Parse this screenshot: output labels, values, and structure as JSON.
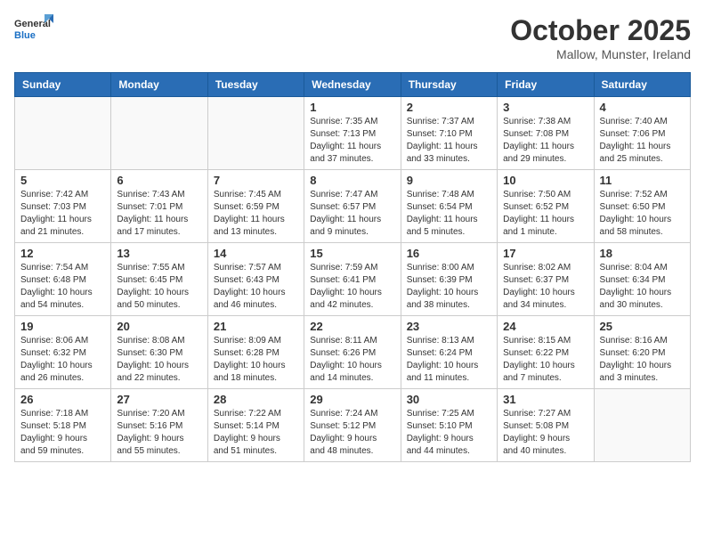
{
  "logo": {
    "text_general": "General",
    "text_blue": "Blue"
  },
  "header": {
    "month": "October 2025",
    "location": "Mallow, Munster, Ireland"
  },
  "weekdays": [
    "Sunday",
    "Monday",
    "Tuesday",
    "Wednesday",
    "Thursday",
    "Friday",
    "Saturday"
  ],
  "weeks": [
    [
      {
        "day": "",
        "info": ""
      },
      {
        "day": "",
        "info": ""
      },
      {
        "day": "",
        "info": ""
      },
      {
        "day": "1",
        "info": "Sunrise: 7:35 AM\nSunset: 7:13 PM\nDaylight: 11 hours\nand 37 minutes."
      },
      {
        "day": "2",
        "info": "Sunrise: 7:37 AM\nSunset: 7:10 PM\nDaylight: 11 hours\nand 33 minutes."
      },
      {
        "day": "3",
        "info": "Sunrise: 7:38 AM\nSunset: 7:08 PM\nDaylight: 11 hours\nand 29 minutes."
      },
      {
        "day": "4",
        "info": "Sunrise: 7:40 AM\nSunset: 7:06 PM\nDaylight: 11 hours\nand 25 minutes."
      }
    ],
    [
      {
        "day": "5",
        "info": "Sunrise: 7:42 AM\nSunset: 7:03 PM\nDaylight: 11 hours\nand 21 minutes."
      },
      {
        "day": "6",
        "info": "Sunrise: 7:43 AM\nSunset: 7:01 PM\nDaylight: 11 hours\nand 17 minutes."
      },
      {
        "day": "7",
        "info": "Sunrise: 7:45 AM\nSunset: 6:59 PM\nDaylight: 11 hours\nand 13 minutes."
      },
      {
        "day": "8",
        "info": "Sunrise: 7:47 AM\nSunset: 6:57 PM\nDaylight: 11 hours\nand 9 minutes."
      },
      {
        "day": "9",
        "info": "Sunrise: 7:48 AM\nSunset: 6:54 PM\nDaylight: 11 hours\nand 5 minutes."
      },
      {
        "day": "10",
        "info": "Sunrise: 7:50 AM\nSunset: 6:52 PM\nDaylight: 11 hours\nand 1 minute."
      },
      {
        "day": "11",
        "info": "Sunrise: 7:52 AM\nSunset: 6:50 PM\nDaylight: 10 hours\nand 58 minutes."
      }
    ],
    [
      {
        "day": "12",
        "info": "Sunrise: 7:54 AM\nSunset: 6:48 PM\nDaylight: 10 hours\nand 54 minutes."
      },
      {
        "day": "13",
        "info": "Sunrise: 7:55 AM\nSunset: 6:45 PM\nDaylight: 10 hours\nand 50 minutes."
      },
      {
        "day": "14",
        "info": "Sunrise: 7:57 AM\nSunset: 6:43 PM\nDaylight: 10 hours\nand 46 minutes."
      },
      {
        "day": "15",
        "info": "Sunrise: 7:59 AM\nSunset: 6:41 PM\nDaylight: 10 hours\nand 42 minutes."
      },
      {
        "day": "16",
        "info": "Sunrise: 8:00 AM\nSunset: 6:39 PM\nDaylight: 10 hours\nand 38 minutes."
      },
      {
        "day": "17",
        "info": "Sunrise: 8:02 AM\nSunset: 6:37 PM\nDaylight: 10 hours\nand 34 minutes."
      },
      {
        "day": "18",
        "info": "Sunrise: 8:04 AM\nSunset: 6:34 PM\nDaylight: 10 hours\nand 30 minutes."
      }
    ],
    [
      {
        "day": "19",
        "info": "Sunrise: 8:06 AM\nSunset: 6:32 PM\nDaylight: 10 hours\nand 26 minutes."
      },
      {
        "day": "20",
        "info": "Sunrise: 8:08 AM\nSunset: 6:30 PM\nDaylight: 10 hours\nand 22 minutes."
      },
      {
        "day": "21",
        "info": "Sunrise: 8:09 AM\nSunset: 6:28 PM\nDaylight: 10 hours\nand 18 minutes."
      },
      {
        "day": "22",
        "info": "Sunrise: 8:11 AM\nSunset: 6:26 PM\nDaylight: 10 hours\nand 14 minutes."
      },
      {
        "day": "23",
        "info": "Sunrise: 8:13 AM\nSunset: 6:24 PM\nDaylight: 10 hours\nand 11 minutes."
      },
      {
        "day": "24",
        "info": "Sunrise: 8:15 AM\nSunset: 6:22 PM\nDaylight: 10 hours\nand 7 minutes."
      },
      {
        "day": "25",
        "info": "Sunrise: 8:16 AM\nSunset: 6:20 PM\nDaylight: 10 hours\nand 3 minutes."
      }
    ],
    [
      {
        "day": "26",
        "info": "Sunrise: 7:18 AM\nSunset: 5:18 PM\nDaylight: 9 hours\nand 59 minutes."
      },
      {
        "day": "27",
        "info": "Sunrise: 7:20 AM\nSunset: 5:16 PM\nDaylight: 9 hours\nand 55 minutes."
      },
      {
        "day": "28",
        "info": "Sunrise: 7:22 AM\nSunset: 5:14 PM\nDaylight: 9 hours\nand 51 minutes."
      },
      {
        "day": "29",
        "info": "Sunrise: 7:24 AM\nSunset: 5:12 PM\nDaylight: 9 hours\nand 48 minutes."
      },
      {
        "day": "30",
        "info": "Sunrise: 7:25 AM\nSunset: 5:10 PM\nDaylight: 9 hours\nand 44 minutes."
      },
      {
        "day": "31",
        "info": "Sunrise: 7:27 AM\nSunset: 5:08 PM\nDaylight: 9 hours\nand 40 minutes."
      },
      {
        "day": "",
        "info": ""
      }
    ]
  ]
}
